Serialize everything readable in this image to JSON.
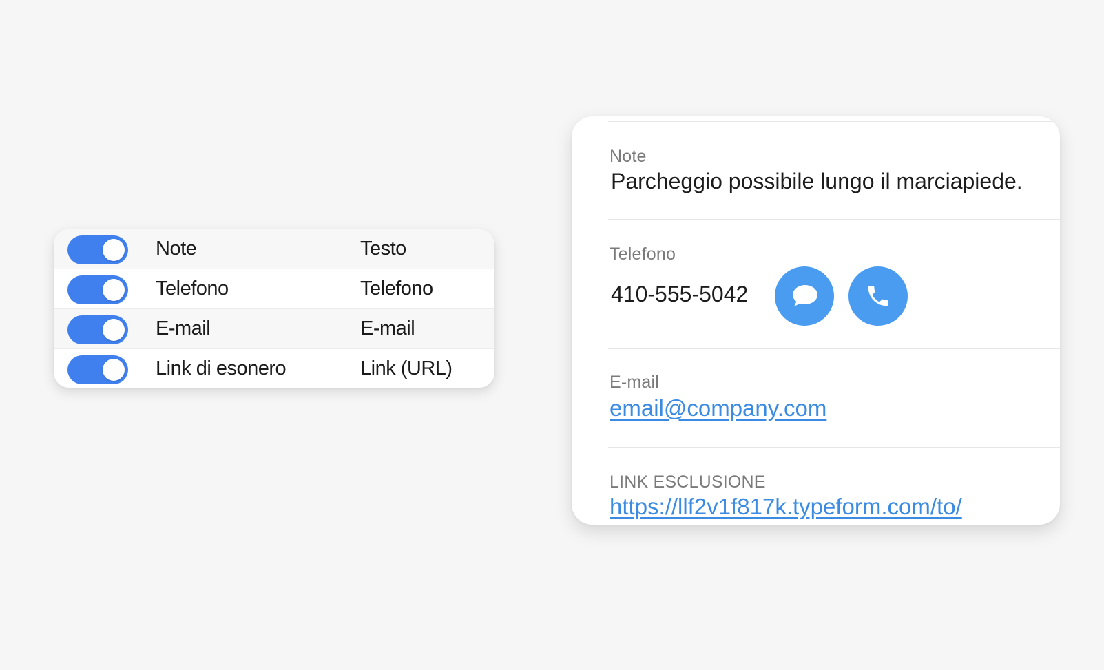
{
  "colors": {
    "toggle_on": "#3f80ee",
    "action_button": "#4a9cf0",
    "link": "#3b8be2"
  },
  "fields_panel": {
    "rows": [
      {
        "enabled": true,
        "name": "Note",
        "type": "Testo"
      },
      {
        "enabled": true,
        "name": "Telefono",
        "type": "Telefono"
      },
      {
        "enabled": true,
        "name": "E-mail",
        "type": "E-mail"
      },
      {
        "enabled": true,
        "name": "Link di esonero",
        "type": "Link (URL)"
      }
    ]
  },
  "detail_card": {
    "note": {
      "label": "Note",
      "value": "Parcheggio possibile lungo il marciapiede."
    },
    "phone": {
      "label": "Telefono",
      "value": "410-555-5042",
      "message_icon": "chat-bubble-icon",
      "call_icon": "phone-icon"
    },
    "email": {
      "label": "E-mail",
      "value": "email@company.com"
    },
    "waiver": {
      "label": "LINK ESCLUSIONE",
      "value": "https://llf2v1f817k.typeform.com/to/"
    }
  }
}
